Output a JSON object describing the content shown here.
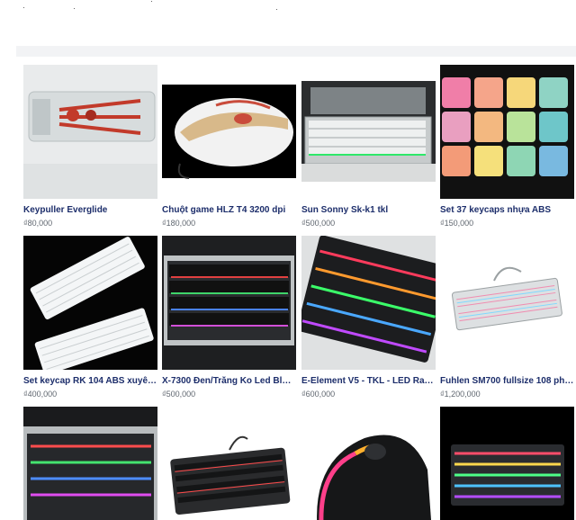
{
  "products": [
    {
      "title": "Keypuller Everglide",
      "price": "₫80,000",
      "icon": "keycap-puller-icon"
    },
    {
      "title": "Chuột game HLZ T4 3200 dpi",
      "price": "₫180,000",
      "icon": "gaming-mouse-icon"
    },
    {
      "title": "Sun Sonny Sk-k1 tkl",
      "price": "₫500,000",
      "icon": "keyboard-icon"
    },
    {
      "title": "Set 37 keycaps nhựa ABS",
      "price": "₫150,000",
      "icon": "keycaps-icon"
    },
    {
      "title": "Set keycap RK 104 ABS xuyên ...",
      "price": "₫400,000",
      "icon": "white-keyboard-icon"
    },
    {
      "title": "X-7300 Đen/Trắng Ko Led Blue ...",
      "price": "₫500,000",
      "icon": "keyboard-icon"
    },
    {
      "title": "E-Element V5 - TKL - LED Rainb...",
      "price": "₫600,000",
      "icon": "rgb-keyboard-icon"
    },
    {
      "title": "Fuhlen SM700 fullsize 108 phím",
      "price": "₫1,200,000",
      "icon": "keyboard-icon"
    },
    {
      "title": "",
      "price": "",
      "icon": "rgb-keyboard-icon"
    },
    {
      "title": "",
      "price": "",
      "icon": "compact-keyboard-icon"
    },
    {
      "title": "",
      "price": "",
      "icon": "gaming-mouse-icon"
    },
    {
      "title": "",
      "price": "",
      "icon": "rgb-keyboard-icon"
    }
  ]
}
